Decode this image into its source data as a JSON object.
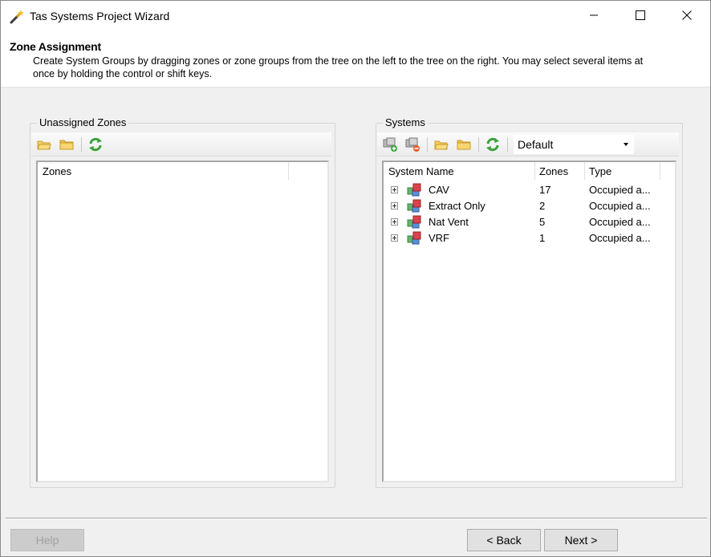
{
  "window": {
    "title": "Tas Systems Project Wizard"
  },
  "header": {
    "title": "Zone Assignment",
    "description": "Create System Groups by dragging zones or zone groups from the tree on the left to the tree on the right.  You may select several items at once by holding the control or shift keys."
  },
  "left_panel": {
    "label": "Unassigned Zones",
    "columns": [
      "Zones"
    ],
    "rows": []
  },
  "right_panel": {
    "label": "Systems",
    "combo_value": "Default",
    "columns": [
      "System Name",
      "Zones",
      "Type"
    ],
    "rows": [
      {
        "name": "CAV",
        "zones": "17",
        "type": "Occupied a..."
      },
      {
        "name": "Extract Only",
        "zones": "2",
        "type": "Occupied a..."
      },
      {
        "name": "Nat Vent",
        "zones": "5",
        "type": "Occupied a..."
      },
      {
        "name": "VRF",
        "zones": "1",
        "type": "Occupied a..."
      }
    ]
  },
  "buttons": {
    "help": "Help",
    "back": "< Back",
    "next": "Next >"
  },
  "icons": {
    "toolbar_left": [
      "open-folder-icon",
      "folder-icon",
      "refresh-icon"
    ],
    "toolbar_right": [
      "add-system-icon",
      "remove-system-icon",
      "open-folder-icon",
      "folder-icon",
      "refresh-icon"
    ],
    "row_icon": "system-cubes-icon"
  },
  "colors": {
    "folder": "#f0c050",
    "refresh": "#3aa13a",
    "system_red": "#d9434a",
    "system_blue": "#5b8fd6",
    "system_green": "#69b36b"
  }
}
